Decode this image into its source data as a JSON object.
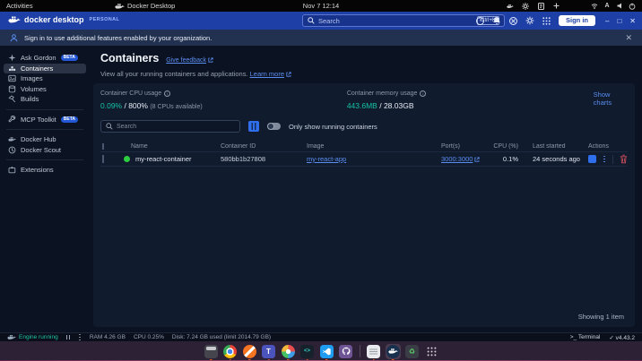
{
  "gnome_bar": {
    "activities": "Activities",
    "focused_app": "Docker Desktop",
    "clock": "Nov 7 12:14",
    "tray_icons": [
      "docker-whale",
      "gear",
      "clipboard",
      "plus"
    ],
    "system_icons": [
      "network",
      "input-a",
      "volume",
      "power"
    ]
  },
  "titlebar": {
    "product": "docker desktop",
    "plan": "PERSONAL",
    "search_placeholder": "Search",
    "shortcut": "Ctrl+K",
    "icons": [
      "help",
      "notifications",
      "troubleshoot",
      "settings",
      "apps-grid"
    ],
    "sign_in": "Sign in",
    "window_controls": {
      "minimize": "–",
      "maximize": "□",
      "close": "✕"
    }
  },
  "banner": {
    "message": "Sign in to use additional features enabled by your organization.",
    "close": "✕"
  },
  "sidebar": {
    "items": [
      {
        "label": "Ask Gordon",
        "badge": "BETA"
      },
      {
        "label": "Containers"
      },
      {
        "label": "Images"
      },
      {
        "label": "Volumes"
      },
      {
        "label": "Builds"
      },
      {
        "label": "MCP Toolkit",
        "badge": "BETA"
      },
      {
        "label": "Docker Hub"
      },
      {
        "label": "Docker Scout"
      },
      {
        "label": "Extensions"
      }
    ],
    "selected": "Containers"
  },
  "page": {
    "title": "Containers",
    "feedback_link": "Give feedback",
    "subtitle": "View all your running containers and applications.",
    "learn_more": "Learn more",
    "metrics": {
      "cpu_label": "Container CPU usage",
      "cpu_value": "0.09%",
      "cpu_total": "/ 800%",
      "cpu_note": "(8 CPUs available)",
      "mem_label": "Container memory usage",
      "mem_value": "443.6MB",
      "mem_total": "/ 28.03GB",
      "show_charts": "Show charts"
    },
    "toolbar": {
      "search_placeholder": "Search",
      "toggle_label": "Only show running containers",
      "toggle_state": "off"
    },
    "table": {
      "headers": [
        "Name",
        "Container ID",
        "Image",
        "Port(s)",
        "CPU (%)",
        "Last started",
        "Actions"
      ],
      "rows": [
        {
          "status": "running",
          "name": "my-react-container",
          "container_id": "580bb1b27808",
          "image": "my-react-app",
          "ports": "3000:3000",
          "cpu": "0.1%",
          "last_started": "24 seconds ago"
        }
      ]
    },
    "footer": {
      "showing": "Showing 1 item"
    }
  },
  "statusbar": {
    "engine": "Engine running",
    "ram": "RAM 4.26 GB",
    "cpu": "CPU 0.25%",
    "disk": "Disk: 7.24 GB used (limit 2014.79 GB)",
    "terminal": ">_ Terminal",
    "version": "✓ v4.43.2"
  },
  "dock": {
    "apps": [
      "files",
      "chrome",
      "screen-annotation",
      "teams",
      "app-launcher",
      "dev-terminal",
      "vscode",
      "github-desktop",
      "notes",
      "docker-desktop",
      "trash",
      "app-grid"
    ],
    "active_app": "docker-desktop"
  },
  "colors": {
    "titlebar_blue": "#1d3fa6",
    "accent_blue": "#2f6fed",
    "link_blue": "#5b8def",
    "metric_teal": "#17c2a3",
    "running_green": "#2ecc40",
    "danger_red": "#d4515e",
    "dock_background": "#2c2135"
  }
}
